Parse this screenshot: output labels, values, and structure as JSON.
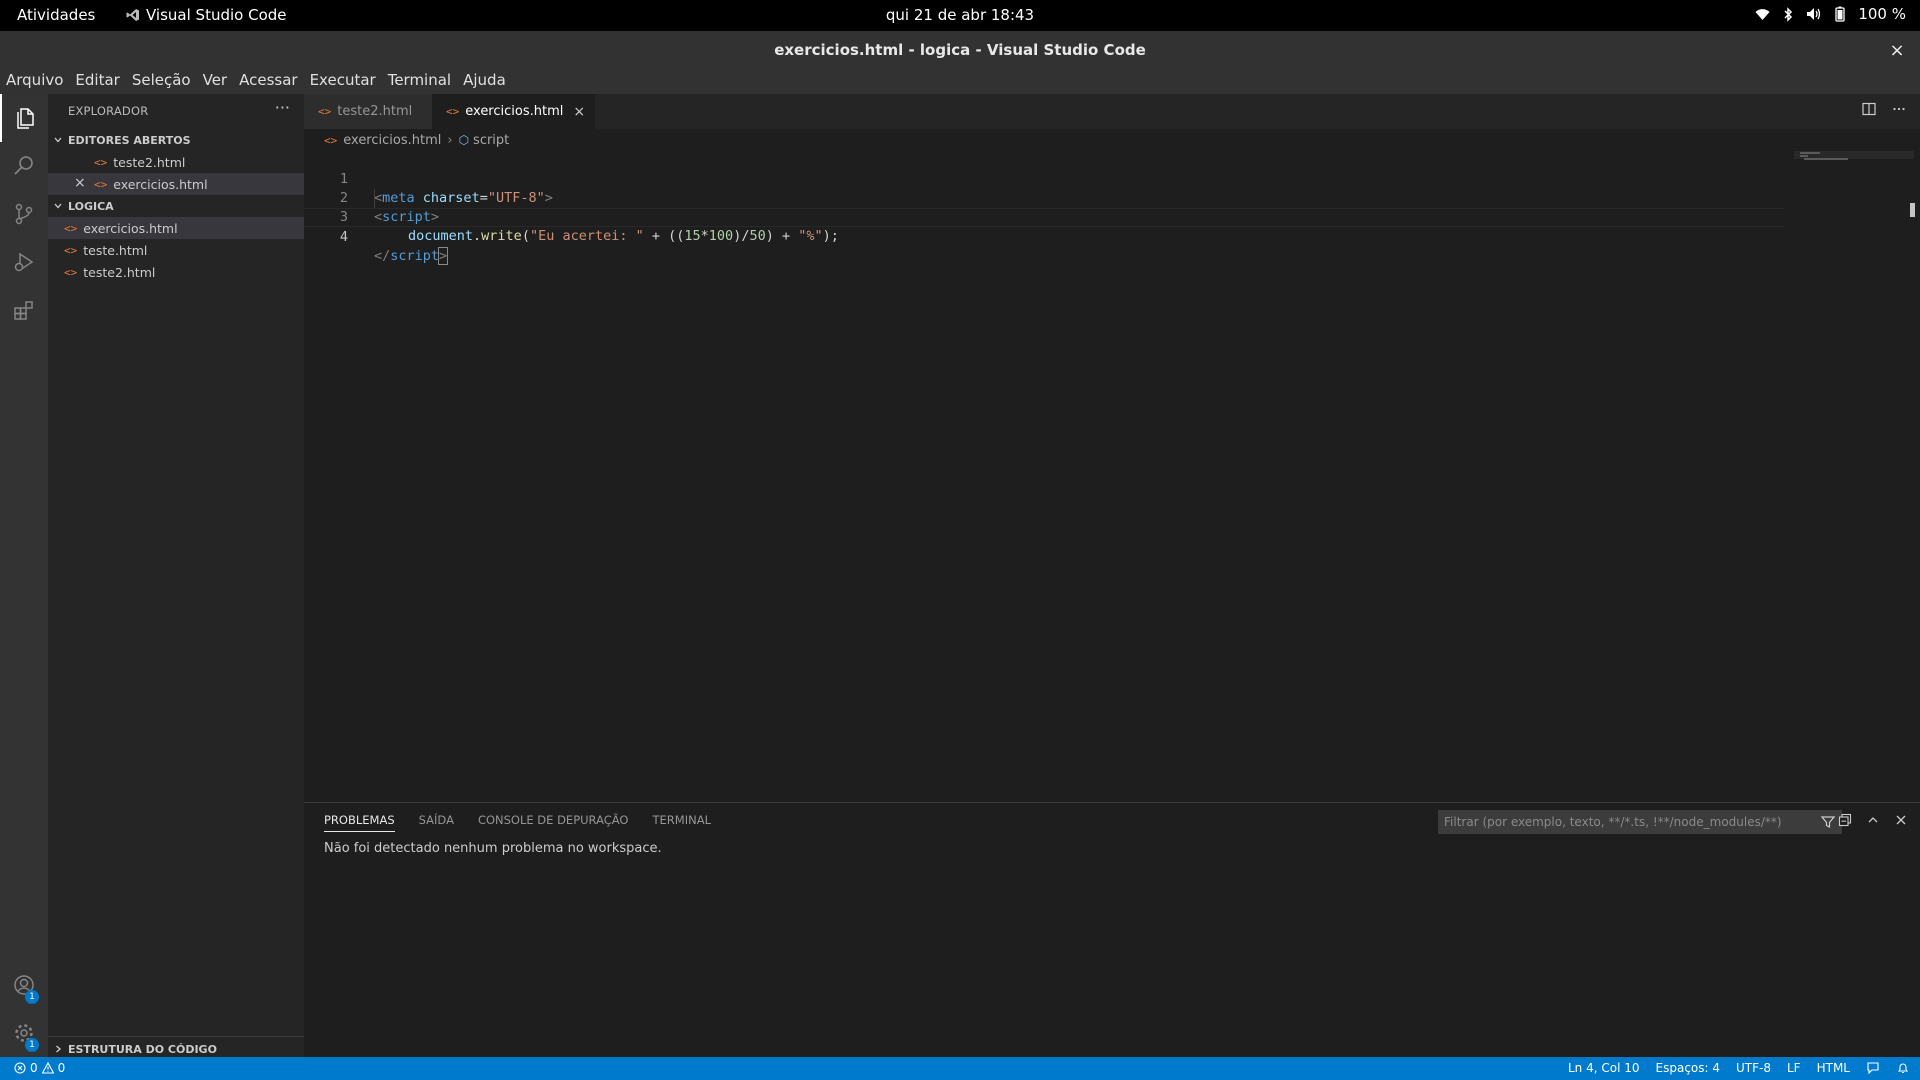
{
  "topbar": {
    "activities": "Atividades",
    "app_name": "Visual Studio Code",
    "clock": "qui 21 de abr  18:43",
    "battery": "100 %"
  },
  "window": {
    "title": "exercicios.html - logica - Visual Studio Code",
    "close": "×"
  },
  "menu": [
    "Arquivo",
    "Editar",
    "Seleção",
    "Ver",
    "Acessar",
    "Executar",
    "Terminal",
    "Ajuda"
  ],
  "activity_bar": {
    "icons": [
      "files-icon",
      "search-icon",
      "source-control-icon",
      "run-debug-icon",
      "extensions-icon"
    ],
    "accounts_badge": "1",
    "settings_badge": "1"
  },
  "sidebar": {
    "header": "EXPLORADOR",
    "more": "···",
    "open_editors_title": "EDITORES ABERTOS",
    "open_editors": [
      {
        "name": "teste2.html"
      },
      {
        "name": "exercicios.html"
      }
    ],
    "folder_title": "LOGICA",
    "files": [
      {
        "name": "exercicios.html"
      },
      {
        "name": "teste.html"
      },
      {
        "name": "teste2.html"
      }
    ],
    "outline_title": "ESTRUTURA DO CÓDIGO",
    "file_icon_glyph": "<>"
  },
  "editor": {
    "tabs": [
      {
        "label": "teste2.html",
        "active": false
      },
      {
        "label": "exercicios.html",
        "active": true
      }
    ],
    "tab_close": "×",
    "breadcrumb": {
      "file": "exercicios.html",
      "symbol": "script"
    },
    "line_numbers": [
      "1",
      "2",
      "3",
      "4"
    ],
    "code": {
      "l1": {
        "open": "<",
        "tag": "meta",
        "attr": "charset",
        "eq": "=",
        "val": "\"UTF-8\"",
        "close": ">"
      },
      "l2": {
        "open": "<",
        "tag": "script",
        "close": ">"
      },
      "l3": {
        "obj": "document",
        "dot": ".",
        "fn": "write",
        "p1": "(",
        "s1": "\"Eu acertei: \"",
        "op1": " + ((",
        "n1": "15",
        "op2": "*",
        "n2": "100",
        "op3": ")/",
        "n3": "50",
        "op4": ") + ",
        "s2": "\"%\"",
        "end": ");"
      },
      "l4": {
        "open": "</",
        "tag": "script",
        "close": ">"
      }
    }
  },
  "panel": {
    "tabs": [
      "PROBLEMAS",
      "SAÍDA",
      "CONSOLE DE DEPURAÇÃO",
      "TERMINAL"
    ],
    "filter_placeholder": "Filtrar (por exemplo, texto, **/*.ts, !**/node_modules/**)",
    "message": "Não foi detectado nenhum problema no workspace."
  },
  "status": {
    "errors": "0",
    "warnings": "0",
    "position": "Ln 4, Col 10",
    "spaces": "Espaços: 4",
    "encoding": "UTF-8",
    "eol": "LF",
    "language": "HTML"
  },
  "colors": {
    "status_bar": "#007acc",
    "file_icon": "#e37933"
  }
}
